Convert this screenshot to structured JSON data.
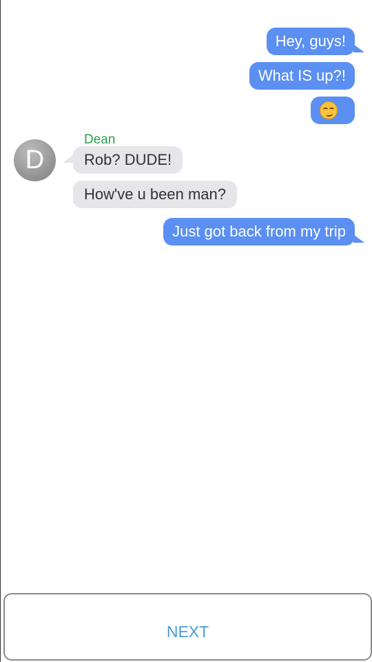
{
  "conversation": {
    "messages": [
      {
        "direction": "outgoing",
        "text": "Hey, guys!"
      },
      {
        "direction": "outgoing",
        "text": "What IS up?!"
      },
      {
        "direction": "outgoing",
        "emoji": "smirking-face-icon"
      },
      {
        "direction": "incoming",
        "sender": "Dean",
        "text": "Rob? DUDE!"
      },
      {
        "direction": "incoming",
        "sender": "Dean",
        "text": "How've u been man?"
      },
      {
        "direction": "outgoing",
        "text": "Just got back from my trip"
      }
    ],
    "contact": {
      "name": "Dean",
      "initial": "D"
    }
  },
  "footer": {
    "next_label": "NEXT"
  },
  "colors": {
    "outgoing_bubble": "#5b8ff2",
    "incoming_bubble": "#e5e5ea",
    "sender_name": "#24a148",
    "next_text": "#4a9cd6"
  }
}
